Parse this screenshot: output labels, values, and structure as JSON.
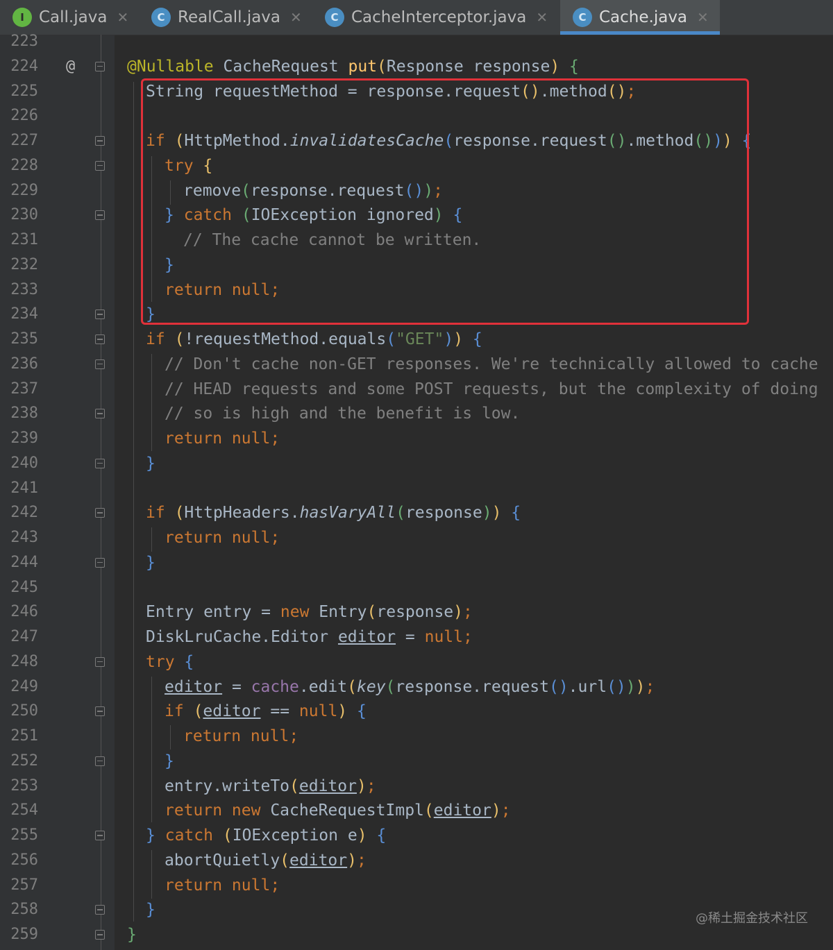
{
  "tabs": [
    {
      "icon": "I",
      "label": "Call.java",
      "active": false
    },
    {
      "icon": "C",
      "label": "RealCall.java",
      "active": false
    },
    {
      "icon": "C",
      "label": "CacheInterceptor.java",
      "active": false
    },
    {
      "icon": "C",
      "label": "Cache.java",
      "active": true
    }
  ],
  "gutter": {
    "override_mark": "@"
  },
  "watermark": "@稀土掘金技术社区",
  "lines": [
    {
      "n": "223",
      "html": ""
    },
    {
      "n": "224",
      "html": "<span class=\"ann\">@Nullable</span> CacheRequest <span class=\"fn\">put</span><span class=\"par-y\">(</span>Response response<span class=\"par-y\">)</span> <span class=\"par-g\">{</span>"
    },
    {
      "n": "225",
      "html": "  String requestMethod = response.request<span class=\"par-y\">()</span>.method<span class=\"par-y\">()</span><span class=\"kw\">;</span>"
    },
    {
      "n": "226",
      "html": ""
    },
    {
      "n": "227",
      "html": "  <span class=\"kw\">if</span> <span class=\"par-y\">(</span>HttpMethod.<span class=\"ital\">invalidatesCache</span><span class=\"par-b\">(</span>response.request<span class=\"par-g\">()</span>.method<span class=\"par-g\">()</span><span class=\"par-b\">)</span><span class=\"par-y\">)</span> <span class=\"par-b\">{</span>"
    },
    {
      "n": "228",
      "html": "    <span class=\"kw\">try</span> <span class=\"par-y\">{</span>"
    },
    {
      "n": "229",
      "html": "      remove<span class=\"par-g\">(</span>response.request<span class=\"par-b\">()</span><span class=\"par-g\">)</span><span class=\"kw\">;</span>"
    },
    {
      "n": "230",
      "html": "    <span class=\"par-b\">}</span> <span class=\"kw\">catch</span> <span class=\"par-g\">(</span>IOException ignored<span class=\"par-g\">)</span> <span class=\"par-b\">{</span>"
    },
    {
      "n": "231",
      "html": "      <span class=\"cmt\">// The cache cannot be written.</span>"
    },
    {
      "n": "232",
      "html": "    <span class=\"par-b\">}</span>"
    },
    {
      "n": "233",
      "html": "    <span class=\"kw\">return null;</span>"
    },
    {
      "n": "234",
      "html": "  <span class=\"par-b\">}</span>"
    },
    {
      "n": "235",
      "html": "  <span class=\"kw\">if</span> <span class=\"par-y\">(</span>!requestMethod.equals<span class=\"par-b\">(</span><span class=\"str\">\"GET\"</span><span class=\"par-b\">)</span><span class=\"par-y\">)</span> <span class=\"par-b\">{</span>"
    },
    {
      "n": "236",
      "html": "    <span class=\"cmt\">// Don't cache non-GET responses. We're technically allowed to cache</span>"
    },
    {
      "n": "237",
      "html": "    <span class=\"cmt\">// HEAD requests and some POST requests, but the complexity of doing</span>"
    },
    {
      "n": "238",
      "html": "    <span class=\"cmt\">// so is high and the benefit is low.</span>"
    },
    {
      "n": "239",
      "html": "    <span class=\"kw\">return null;</span>"
    },
    {
      "n": "240",
      "html": "  <span class=\"par-b\">}</span>"
    },
    {
      "n": "241",
      "html": ""
    },
    {
      "n": "242",
      "html": "  <span class=\"kw\">if</span> <span class=\"par-y\">(</span>HttpHeaders.<span class=\"ital\">hasVaryAll</span><span class=\"par-g\">(</span>response<span class=\"par-g\">)</span><span class=\"par-y\">)</span> <span class=\"par-b\">{</span>"
    },
    {
      "n": "243",
      "html": "    <span class=\"kw\">return null;</span>"
    },
    {
      "n": "244",
      "html": "  <span class=\"par-b\">}</span>"
    },
    {
      "n": "245",
      "html": ""
    },
    {
      "n": "246",
      "html": "  Entry entry = <span class=\"kw\">new</span> Entry<span class=\"par-y\">(</span>response<span class=\"par-y\">)</span><span class=\"kw\">;</span>"
    },
    {
      "n": "247",
      "html": "  DiskLruCache.Editor <span class=\"ul\">editor</span> = <span class=\"kw\">null;</span>"
    },
    {
      "n": "248",
      "html": "  <span class=\"kw\">try</span> <span class=\"par-b\">{</span>"
    },
    {
      "n": "249",
      "html": "    <span class=\"ul\">editor</span> = <span class=\"field\">cache</span>.edit<span class=\"par-y\">(</span><span class=\"ital\">key</span><span class=\"par-g\">(</span>response.request<span class=\"par-b\">()</span>.url<span class=\"par-b\">()</span><span class=\"par-g\">)</span><span class=\"par-y\">)</span><span class=\"kw\">;</span>"
    },
    {
      "n": "250",
      "html": "    <span class=\"kw\">if</span> <span class=\"par-y\">(</span><span class=\"ul\">editor</span> == <span class=\"kw\">null</span><span class=\"par-y\">)</span> <span class=\"par-b\">{</span>"
    },
    {
      "n": "251",
      "html": "      <span class=\"kw\">return null;</span>"
    },
    {
      "n": "252",
      "html": "    <span class=\"par-b\">}</span>"
    },
    {
      "n": "253",
      "html": "    entry.writeTo<span class=\"par-y\">(</span><span class=\"ul\">editor</span><span class=\"par-y\">)</span><span class=\"kw\">;</span>"
    },
    {
      "n": "254",
      "html": "    <span class=\"kw\">return new</span> CacheRequestImpl<span class=\"par-y\">(</span><span class=\"ul\">editor</span><span class=\"par-y\">)</span><span class=\"kw\">;</span>"
    },
    {
      "n": "255",
      "html": "  <span class=\"par-b\">}</span> <span class=\"kw\">catch</span> <span class=\"par-y\">(</span>IOException e<span class=\"par-y\">)</span> <span class=\"par-b\">{</span>"
    },
    {
      "n": "256",
      "html": "    abortQuietly<span class=\"par-y\">(</span><span class=\"ul\">editor</span><span class=\"par-y\">)</span><span class=\"kw\">;</span>"
    },
    {
      "n": "257",
      "html": "    <span class=\"kw\">return null;</span>"
    },
    {
      "n": "258",
      "html": "  <span class=\"par-b\">}</span>"
    },
    {
      "n": "259",
      "html": "<span class=\"par-g\">}</span>"
    }
  ]
}
